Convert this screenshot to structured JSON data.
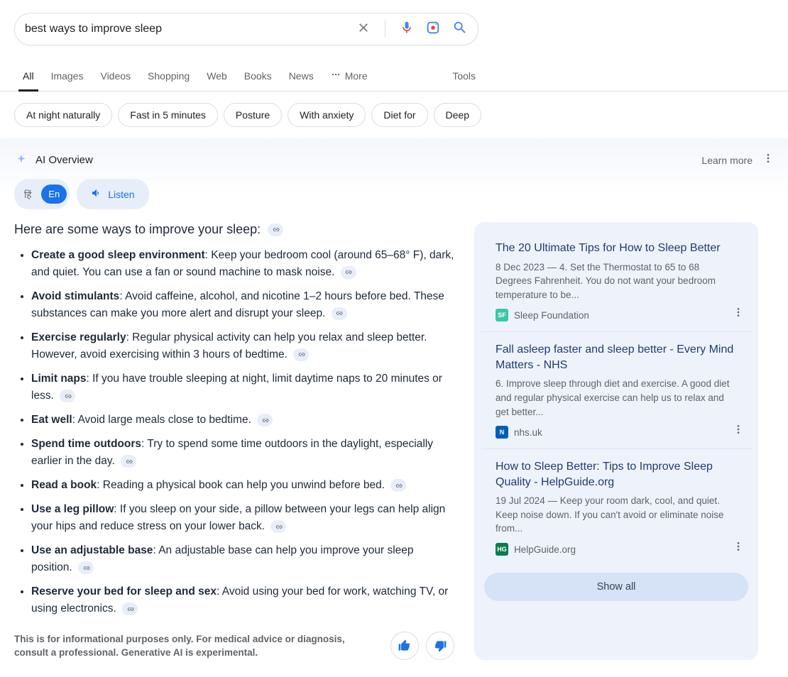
{
  "search": {
    "query": "best ways to improve sleep"
  },
  "tabs": [
    "All",
    "Images",
    "Videos",
    "Shopping",
    "Web",
    "Books",
    "News"
  ],
  "more_label": "More",
  "tools_label": "Tools",
  "chips": [
    "At night naturally",
    "Fast in 5 minutes",
    "Posture",
    "With anxiety",
    "Diet for",
    "Deep"
  ],
  "ai": {
    "title": "AI Overview",
    "learn_more": "Learn more",
    "lang_hi": "हिं",
    "lang_en": "En",
    "listen": "Listen",
    "intro": "Here are some ways to improve your sleep:",
    "tips": [
      {
        "head": "Create a good sleep environment",
        "body": ": Keep your bedroom cool (around 65–68° F), dark, and quiet. You can use a fan or sound machine to mask noise."
      },
      {
        "head": "Avoid stimulants",
        "body": ": Avoid caffeine, alcohol, and nicotine 1–2 hours before bed. These substances can make you more alert and disrupt your sleep."
      },
      {
        "head": "Exercise regularly",
        "body": ": Regular physical activity can help you relax and sleep better. However, avoid exercising within 3 hours of bedtime."
      },
      {
        "head": "Limit naps",
        "body": ": If you have trouble sleeping at night, limit daytime naps to 20 minutes or less."
      },
      {
        "head": "Eat well",
        "body": ": Avoid large meals close to bedtime."
      },
      {
        "head": "Spend time outdoors",
        "body": ": Try to spend some time outdoors in the daylight, especially earlier in the day."
      },
      {
        "head": "Read a book",
        "body": ": Reading a physical book can help you unwind before bed."
      },
      {
        "head": "Use a leg pillow",
        "body": ": If you sleep on your side, a pillow between your legs can help align your hips and reduce stress on your lower back."
      },
      {
        "head": "Use an adjustable base",
        "body": ": An adjustable base can help you improve your sleep position."
      },
      {
        "head": "Reserve your bed for sleep and sex",
        "body": ": Avoid using your bed for work, watching TV, or using electronics."
      }
    ],
    "disclaimer": "This is for informational purposes only. For medical advice or diagnosis, consult a professional. Generative AI is experimental.",
    "show_all": "Show all"
  },
  "sources": [
    {
      "title": "The 20 Ultimate Tips for How to Sleep Better",
      "snippet": "8 Dec 2023 — 4. Set the Thermostat to 65 to 68 Degrees Fahrenheit. You do not want your bedroom temperature to be...",
      "site": "Sleep Foundation",
      "favcolor": "#3cc6a5",
      "favtext": "SF"
    },
    {
      "title": "Fall asleep faster and sleep better - Every Mind Matters - NHS",
      "snippet": "6. Improve sleep through diet and exercise. A good diet and regular physical exercise can help us to relax and get better...",
      "site": "nhs.uk",
      "favcolor": "#005eb8",
      "favtext": "N"
    },
    {
      "title": "How to Sleep Better: Tips to Improve Sleep Quality - HelpGuide.org",
      "snippet": "19 Jul 2024 — Keep your room dark, cool, and quiet. Keep noise down. If you can't avoid or eliminate noise from...",
      "site": "HelpGuide.org",
      "favcolor": "#0a7d4f",
      "favtext": "HG"
    }
  ]
}
